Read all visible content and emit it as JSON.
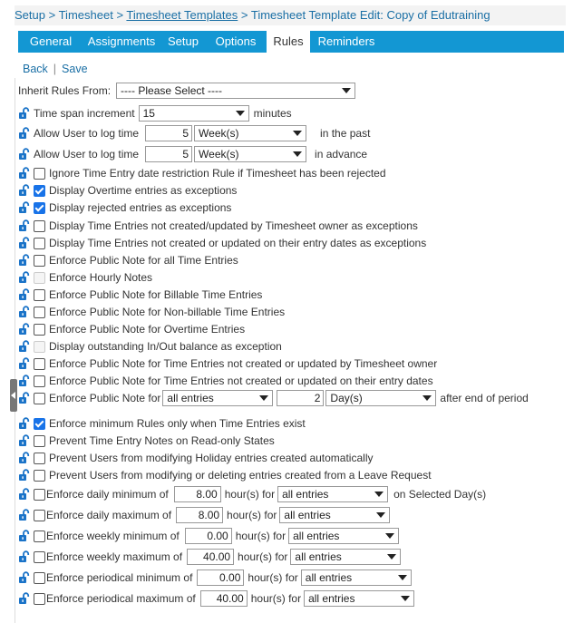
{
  "breadcrumb": {
    "setup": "Setup",
    "sep": ">",
    "timesheet": "Timesheet",
    "templates": "Timesheet Templates",
    "current": "Timesheet Template Edit: Copy of Edutraining"
  },
  "tabs": [
    "General",
    "Assignments",
    "Setup",
    "Options",
    "Rules",
    "Reminders"
  ],
  "active_tab": "Rules",
  "actions": {
    "back": "Back",
    "sep": "|",
    "save": "Save"
  },
  "inherit": {
    "label": "Inherit Rules From:",
    "value": "---- Please Select ----"
  },
  "time_span": {
    "label": "Time span increment",
    "value": "15",
    "unit": "minutes"
  },
  "log_past": {
    "label": "Allow User to log time",
    "number": "5",
    "period": "Week(s)",
    "suffix": "in the past"
  },
  "log_advance": {
    "label": "Allow User to log time",
    "number": "5",
    "period": "Week(s)",
    "suffix": "in advance"
  },
  "rules": [
    {
      "label": "Ignore Time Entry date restriction Rule if Timesheet has been rejected",
      "checked": false,
      "disabled": false
    },
    {
      "label": "Display Overtime entries as exceptions",
      "checked": true,
      "disabled": false
    },
    {
      "label": "Display rejected entries as exceptions",
      "checked": true,
      "disabled": false
    },
    {
      "label": "Display Time Entries not created/updated by Timesheet owner as exceptions",
      "checked": false,
      "disabled": false
    },
    {
      "label": "Display Time Entries not created or updated on their entry dates as exceptions",
      "checked": false,
      "disabled": false
    },
    {
      "label": "Enforce Public Note for all Time Entries",
      "checked": false,
      "disabled": false
    },
    {
      "label": "Enforce Hourly Notes",
      "checked": false,
      "disabled": true
    },
    {
      "label": "Enforce Public Note for Billable Time Entries",
      "checked": false,
      "disabled": false
    },
    {
      "label": "Enforce Public Note for Non-billable Time Entries",
      "checked": false,
      "disabled": false
    },
    {
      "label": "Enforce Public Note for Overtime Entries",
      "checked": false,
      "disabled": false
    },
    {
      "label": "Display outstanding In/Out balance as exception",
      "checked": false,
      "disabled": true
    },
    {
      "label": "Enforce Public Note for Time Entries not created or updated by Timesheet owner",
      "checked": false,
      "disabled": false
    },
    {
      "label": "Enforce Public Note for Time Entries not created or updated on their entry dates",
      "checked": false,
      "disabled": false
    }
  ],
  "public_note_period": {
    "label": "Enforce Public Note for",
    "entries": "all entries",
    "number": "2",
    "period": "Day(s)",
    "suffix": "after end of period"
  },
  "rules2": [
    {
      "label": "Enforce minimum Rules only when Time Entries exist",
      "checked": true
    },
    {
      "label": "Prevent Time Entry Notes on Read-only States",
      "checked": false
    },
    {
      "label": "Prevent Users from modifying Holiday entries created automatically",
      "checked": false
    },
    {
      "label": "Prevent Users from modifying or deleting entries created from a Leave Request",
      "checked": false
    }
  ],
  "limits": [
    {
      "label": "Enforce daily minimum of",
      "value": "8.00",
      "unit": "hour(s) for",
      "entries": "all entries",
      "suffix": "on Selected Day(s)"
    },
    {
      "label": "Enforce daily maximum of",
      "value": "8.00",
      "unit": "hour(s) for",
      "entries": "all entries",
      "suffix": ""
    },
    {
      "label": "Enforce weekly minimum of",
      "value": "0.00",
      "unit": "hour(s) for",
      "entries": "all entries",
      "suffix": ""
    },
    {
      "label": "Enforce weekly maximum of",
      "value": "40.00",
      "unit": "hour(s) for",
      "entries": "all entries",
      "suffix": ""
    },
    {
      "label": "Enforce periodical minimum of",
      "value": "0.00",
      "unit": "hour(s) for",
      "entries": "all entries",
      "suffix": ""
    },
    {
      "label": "Enforce periodical maximum of",
      "value": "40.00",
      "unit": "hour(s) for",
      "entries": "all entries",
      "suffix": ""
    }
  ],
  "colors": {
    "tab_bar": "#1397d3",
    "link": "#1a6fa5",
    "check": "#1873e8",
    "lock": "#1a73c8"
  },
  "icons": {
    "lock": "unlocked-padlock-icon",
    "handle": "collapse-handle-icon"
  }
}
